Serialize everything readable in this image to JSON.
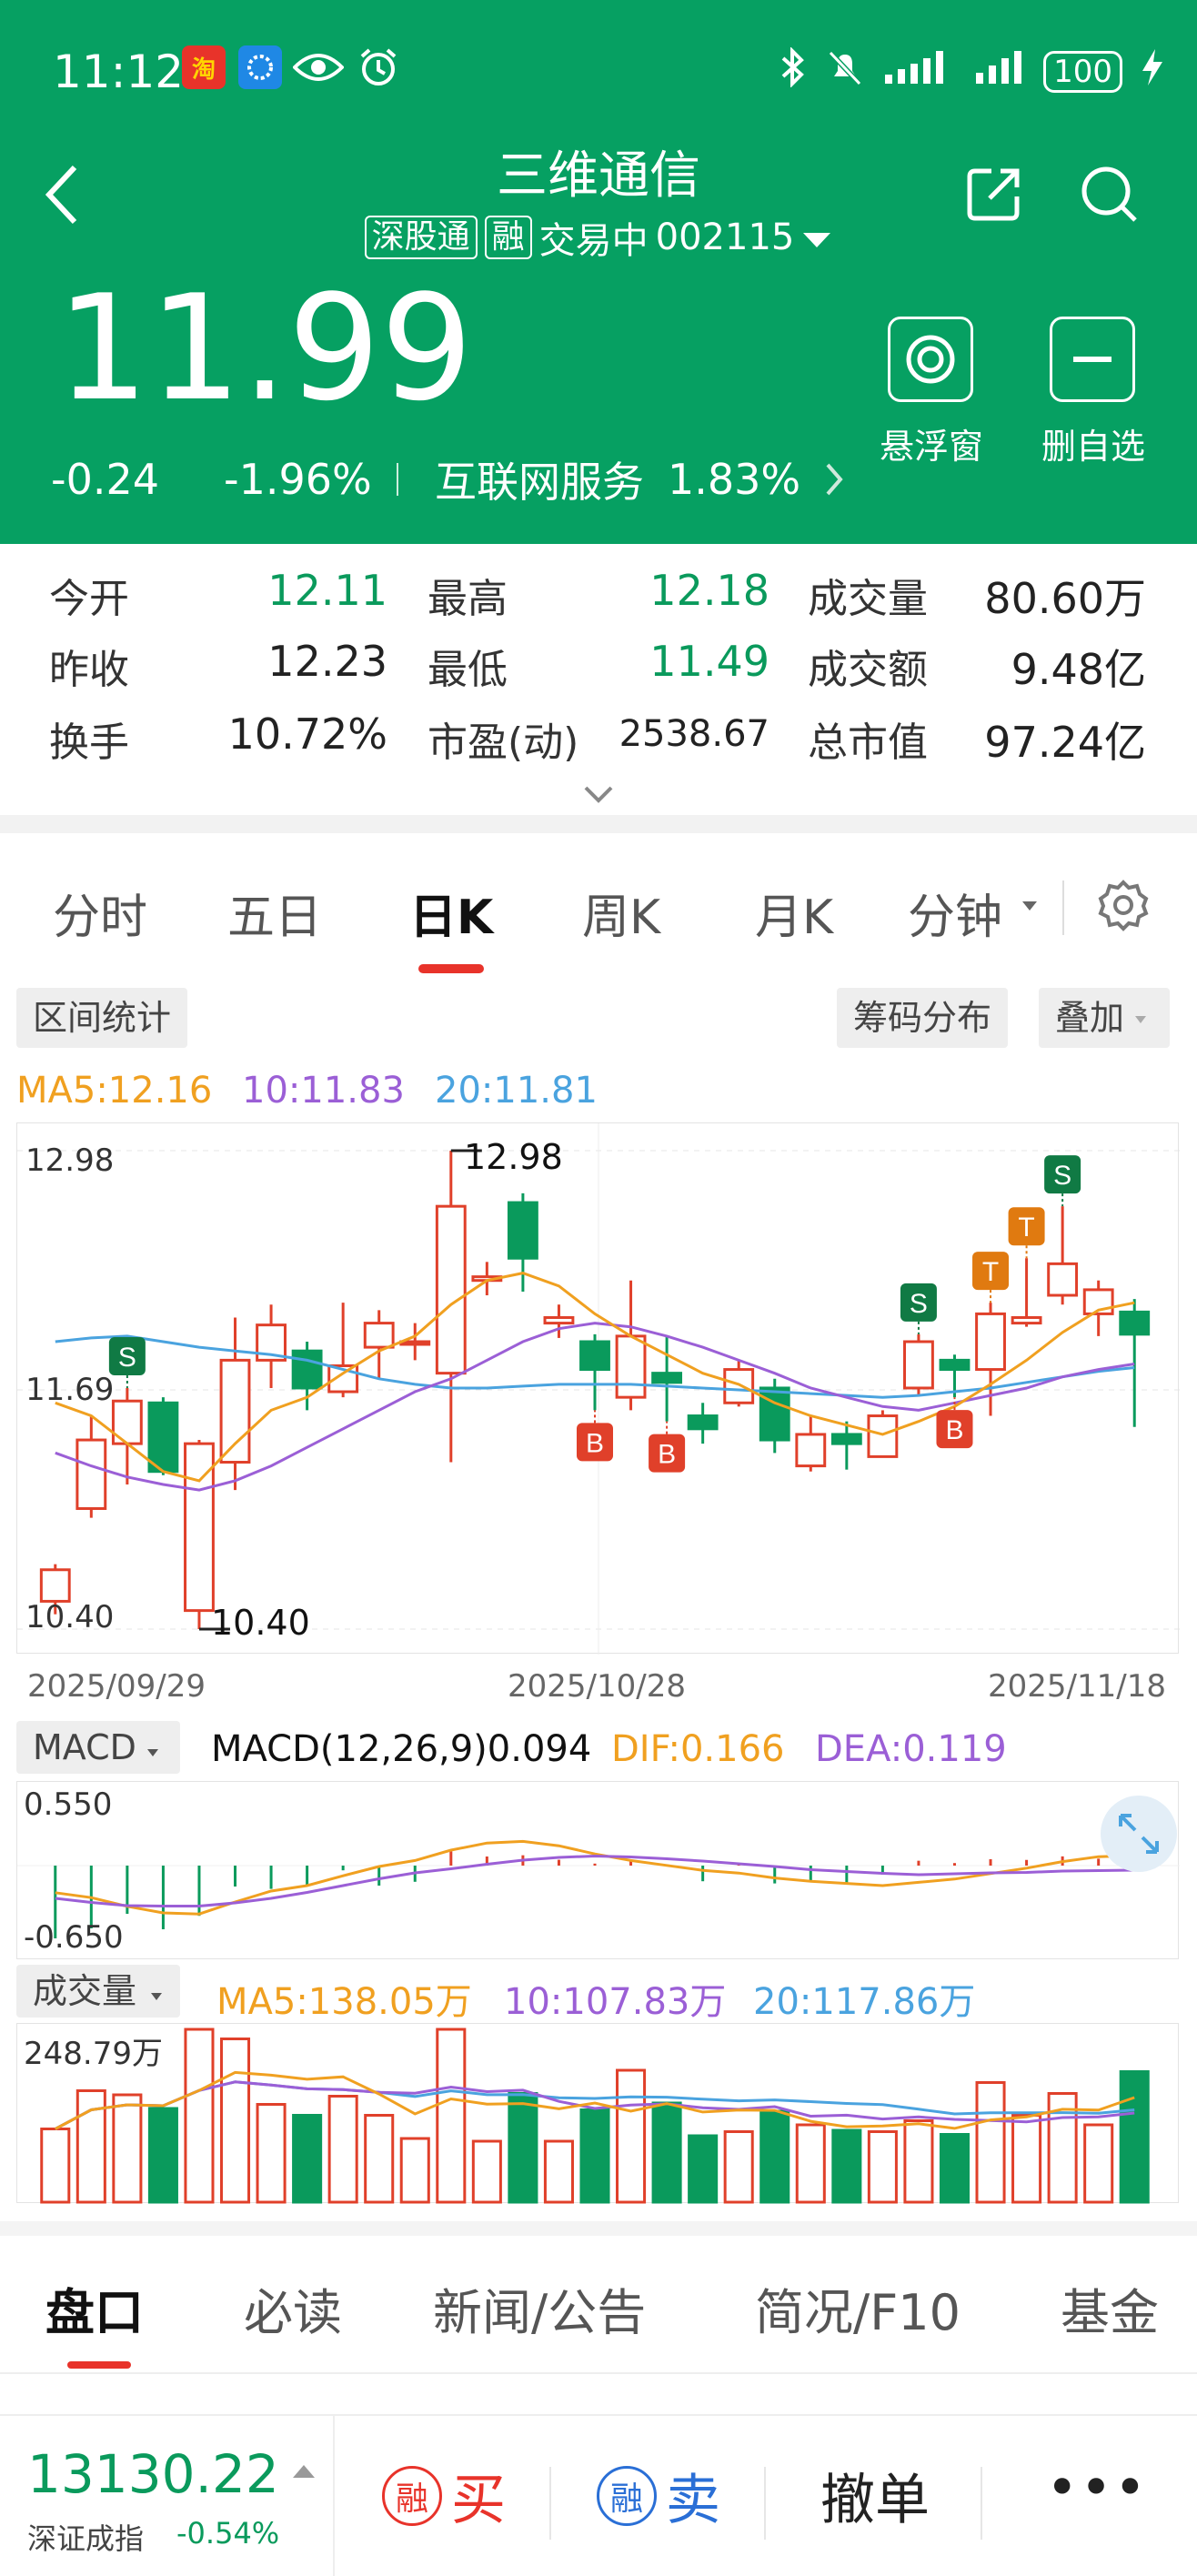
{
  "status_bar": {
    "time": "11:12",
    "battery": "100"
  },
  "header": {
    "title": "三维通信",
    "tag_sz": "深股通",
    "tag_rong": "融",
    "trading_status": "交易中",
    "code": "002115",
    "price": "11.99",
    "change": "-0.24",
    "change_pct": "-1.96%",
    "sector": "互联网服务",
    "sector_pct": "1.83%",
    "float_label": "悬浮窗",
    "remove_label": "删自选"
  },
  "stats": {
    "open_label": "今开",
    "open": "12.11",
    "high_label": "最高",
    "high": "12.18",
    "volume_label": "成交量",
    "volume": "80.60万",
    "prev_label": "昨收",
    "prev": "12.23",
    "low_label": "最低",
    "low": "11.49",
    "amount_label": "成交额",
    "amount": "9.48亿",
    "turnover_label": "换手",
    "turnover": "10.72%",
    "pe_label": "市盈(动)",
    "pe": "2538.67",
    "mktcap_label": "总市值",
    "mktcap": "97.24亿"
  },
  "chart_tabs": [
    "分时",
    "五日",
    "日K",
    "周K",
    "月K",
    "分钟"
  ],
  "chips": {
    "range": "区间统计",
    "chips": "筹码分布",
    "overlay": "叠加"
  },
  "ma": {
    "ma5": "MA5:12.16",
    "ma10": "10:11.83",
    "ma20": "20:11.81"
  },
  "colors": {
    "up": "#e0402a",
    "down": "#0a9a5c",
    "ma5": "#f0a020",
    "ma10": "#9b5fd6",
    "ma20": "#4aa3df",
    "brand": "#06a062"
  },
  "chart_data": {
    "type": "candlestick",
    "dates": [
      "2025/09/29",
      "2025/10/28",
      "2025/11/18"
    ],
    "y_top": "12.98",
    "y_mid": "11.69",
    "y_bottom": "10.40",
    "max_label": "12.98",
    "min_label": "10.40",
    "candles": [
      {
        "o": 10.55,
        "c": 10.72,
        "h": 10.75,
        "l": 10.48
      },
      {
        "o": 11.05,
        "c": 11.42,
        "h": 11.55,
        "l": 11.0
      },
      {
        "o": 11.4,
        "c": 11.63,
        "h": 11.7,
        "l": 11.18
      },
      {
        "o": 11.62,
        "c": 11.25,
        "h": 11.65,
        "l": 11.23
      },
      {
        "o": 10.5,
        "c": 11.4,
        "h": 11.42,
        "l": 10.4
      },
      {
        "o": 11.3,
        "c": 11.85,
        "h": 12.08,
        "l": 11.15
      },
      {
        "o": 11.85,
        "c": 12.04,
        "h": 12.15,
        "l": 11.7
      },
      {
        "o": 11.9,
        "c": 11.7,
        "h": 11.95,
        "l": 11.58
      },
      {
        "o": 11.68,
        "c": 11.82,
        "h": 12.16,
        "l": 11.65
      },
      {
        "o": 11.92,
        "c": 12.05,
        "h": 12.12,
        "l": 11.75
      },
      {
        "o": 11.95,
        "c": 11.95,
        "h": 12.05,
        "l": 11.85
      },
      {
        "o": 11.78,
        "c": 12.68,
        "h": 12.98,
        "l": 11.3
      },
      {
        "o": 12.28,
        "c": 12.3,
        "h": 12.38,
        "l": 12.2
      },
      {
        "o": 12.7,
        "c": 12.4,
        "h": 12.75,
        "l": 12.22
      },
      {
        "o": 12.05,
        "c": 12.08,
        "h": 12.15,
        "l": 11.97
      },
      {
        "o": 11.95,
        "c": 11.8,
        "h": 11.99,
        "l": 11.58
      },
      {
        "o": 11.65,
        "c": 11.98,
        "h": 12.28,
        "l": 11.58
      },
      {
        "o": 11.78,
        "c": 11.73,
        "h": 11.98,
        "l": 11.52
      },
      {
        "o": 11.55,
        "c": 11.48,
        "h": 11.62,
        "l": 11.4
      },
      {
        "o": 11.62,
        "c": 11.8,
        "h": 11.85,
        "l": 11.6
      },
      {
        "o": 11.7,
        "c": 11.42,
        "h": 11.75,
        "l": 11.35
      },
      {
        "o": 11.28,
        "c": 11.45,
        "h": 11.55,
        "l": 11.25
      },
      {
        "o": 11.45,
        "c": 11.4,
        "h": 11.52,
        "l": 11.26
      },
      {
        "o": 11.33,
        "c": 11.55,
        "h": 11.58,
        "l": 11.33
      },
      {
        "o": 11.7,
        "c": 11.95,
        "h": 11.99,
        "l": 11.66
      },
      {
        "o": 11.85,
        "c": 11.8,
        "h": 11.88,
        "l": 11.65
      },
      {
        "o": 11.8,
        "c": 12.1,
        "h": 12.16,
        "l": 11.55
      },
      {
        "o": 12.05,
        "c": 12.08,
        "h": 12.4,
        "l": 12.03
      },
      {
        "o": 12.2,
        "c": 12.37,
        "h": 12.68,
        "l": 12.15
      },
      {
        "o": 12.1,
        "c": 12.23,
        "h": 12.28,
        "l": 11.98
      },
      {
        "o": 12.11,
        "c": 11.99,
        "h": 12.18,
        "l": 11.49
      }
    ],
    "ma5": [
      11.62,
      11.55,
      11.4,
      11.25,
      11.2,
      11.4,
      11.58,
      11.65,
      11.78,
      11.9,
      11.98,
      12.15,
      12.28,
      12.32,
      12.25,
      12.1,
      11.98,
      11.88,
      11.78,
      11.72,
      11.62,
      11.55,
      11.5,
      11.45,
      11.52,
      11.6,
      11.72,
      11.85,
      12.0,
      12.12,
      12.16
    ],
    "ma10": [
      11.35,
      11.28,
      11.22,
      11.18,
      11.15,
      11.2,
      11.28,
      11.38,
      11.48,
      11.58,
      11.68,
      11.75,
      11.85,
      11.95,
      12.02,
      12.05,
      12.03,
      11.98,
      11.92,
      11.85,
      11.78,
      11.7,
      11.65,
      11.6,
      11.58,
      11.62,
      11.66,
      11.7,
      11.76,
      11.8,
      11.83
    ],
    "ma20": [
      11.95,
      11.97,
      11.98,
      11.95,
      11.92,
      11.9,
      11.88,
      11.85,
      11.8,
      11.75,
      11.72,
      11.7,
      11.7,
      11.71,
      11.72,
      11.72,
      11.72,
      11.71,
      11.7,
      11.69,
      11.68,
      11.67,
      11.66,
      11.65,
      11.66,
      11.68,
      11.7,
      11.73,
      11.76,
      11.79,
      11.81
    ],
    "markers": [
      {
        "i": 2,
        "type": "S"
      },
      {
        "i": 15,
        "type": "B"
      },
      {
        "i": 17,
        "type": "B"
      },
      {
        "i": 24,
        "type": "S"
      },
      {
        "i": 25,
        "type": "B"
      },
      {
        "i": 26,
        "type": "T"
      },
      {
        "i": 27,
        "type": "T"
      },
      {
        "i": 28,
        "type": "S"
      }
    ]
  },
  "macd": {
    "label": "MACD",
    "params": "MACD(12,26,9)0.094",
    "dif": "DIF:0.166",
    "dea": "DEA:0.119",
    "y_top": "0.550",
    "y_bottom": "-0.650"
  },
  "volume": {
    "label": "成交量",
    "ma5": "MA5:138.05万",
    "ma10": "10:107.83万",
    "ma20": "20:117.86万",
    "y_top": "248.79万"
  },
  "bottom_tabs": [
    "盘口",
    "必读",
    "新闻/公告",
    "简况/F10",
    "基金"
  ],
  "index": {
    "value": "13130.22",
    "name": "深证成指",
    "change": "-0.54%"
  },
  "actions": {
    "buy_badge": "融",
    "buy": "买",
    "sell_badge": "融",
    "sell": "卖",
    "cancel": "撤单",
    "more": "•••"
  }
}
